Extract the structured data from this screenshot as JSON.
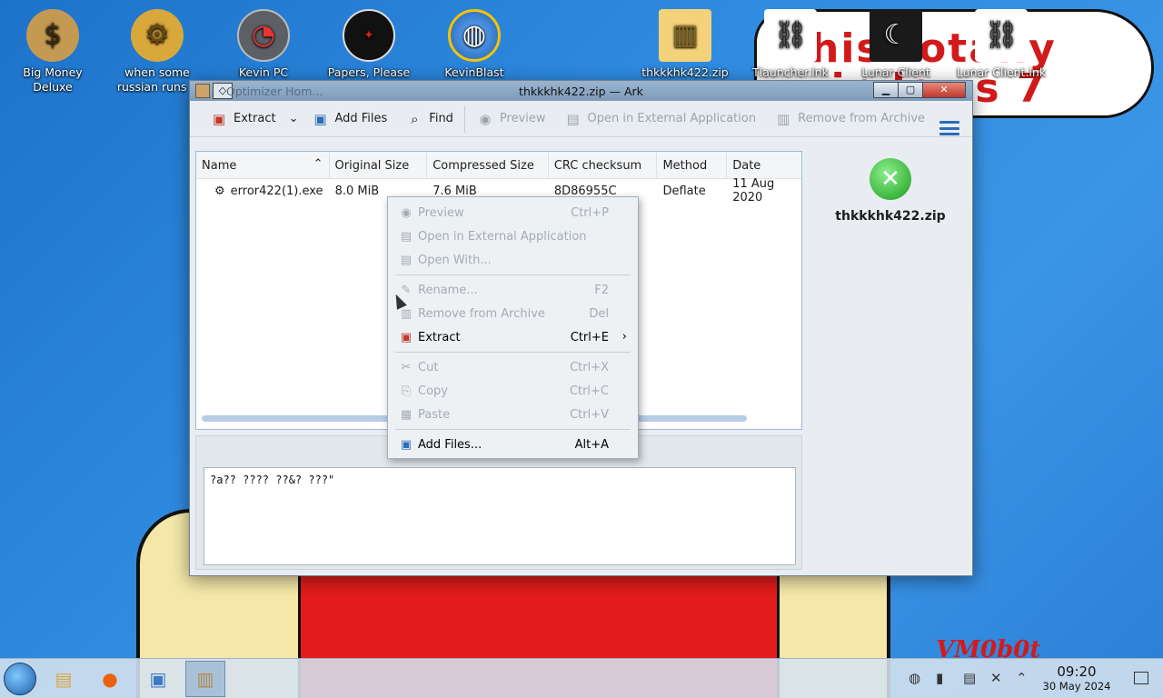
{
  "desktop": {
    "wallpaper_text_line1": "his totally",
    "wallpaper_text_line2": "windows 7 guys",
    "wallpaper_signature": "VM0b0t",
    "icons": [
      {
        "label": "Big Money Deluxe",
        "icon": "money-bag-icon"
      },
      {
        "label": "when some russian runs a",
        "icon": "gear-icon"
      },
      {
        "label": "Kevin PC",
        "icon": "gauge-icon"
      },
      {
        "label": "Papers, Please",
        "icon": "papers-please-icon"
      },
      {
        "label": "KevinBlast Launcher",
        "icon": "globe-icon"
      },
      {
        "label": "thkkkhk422.zip",
        "icon": "zip-folder-icon"
      },
      {
        "label": "Tlauncher.lnk",
        "icon": "link-icon"
      },
      {
        "label": "Lunar Client",
        "icon": "lunar-client-icon"
      },
      {
        "label": "Lunar Client.lnk",
        "icon": "link-icon"
      }
    ]
  },
  "window": {
    "title": "thkkkhk422.zip — Ark",
    "ghost_title": "Optimizer Hom..."
  },
  "toolbar": {
    "extract": "Extract",
    "add_files": "Add Files",
    "find": "Find",
    "preview": "Preview",
    "open_external": "Open in External Application",
    "remove": "Remove from Archive"
  },
  "file_table": {
    "columns": [
      "Name",
      "Original Size",
      "Compressed Size",
      "CRC checksum",
      "Method",
      "Date"
    ],
    "rows": [
      {
        "name": "error422(1).exe",
        "original_size": "8.0 MiB",
        "compressed_size": "7.6 MiB",
        "crc": "8D86955C",
        "method": "Deflate",
        "date": "11 Aug 2020"
      }
    ]
  },
  "side_panel": {
    "archive_name": "thkkkhk422.zip"
  },
  "comment": {
    "text": "?a?? ???? ??&? ???\""
  },
  "context_menu": {
    "items": [
      {
        "label": "Preview",
        "shortcut": "Ctrl+P",
        "enabled": false
      },
      {
        "label": "Open in External Application",
        "shortcut": "",
        "enabled": false
      },
      {
        "label": "Open With...",
        "shortcut": "",
        "enabled": false
      },
      {
        "label": "Rename...",
        "shortcut": "F2",
        "enabled": false
      },
      {
        "label": "Remove from Archive",
        "shortcut": "Del",
        "enabled": false
      },
      {
        "label": "Extract",
        "shortcut": "Ctrl+E",
        "enabled": true
      },
      {
        "label": "Cut",
        "shortcut": "Ctrl+X",
        "enabled": false
      },
      {
        "label": "Copy",
        "shortcut": "Ctrl+C",
        "enabled": false
      },
      {
        "label": "Paste",
        "shortcut": "Ctrl+V",
        "enabled": false
      },
      {
        "label": "Add Files...",
        "shortcut": "Alt+A",
        "enabled": true
      }
    ]
  },
  "taskbar": {
    "time": "09:20",
    "date": "30 May 2024"
  }
}
